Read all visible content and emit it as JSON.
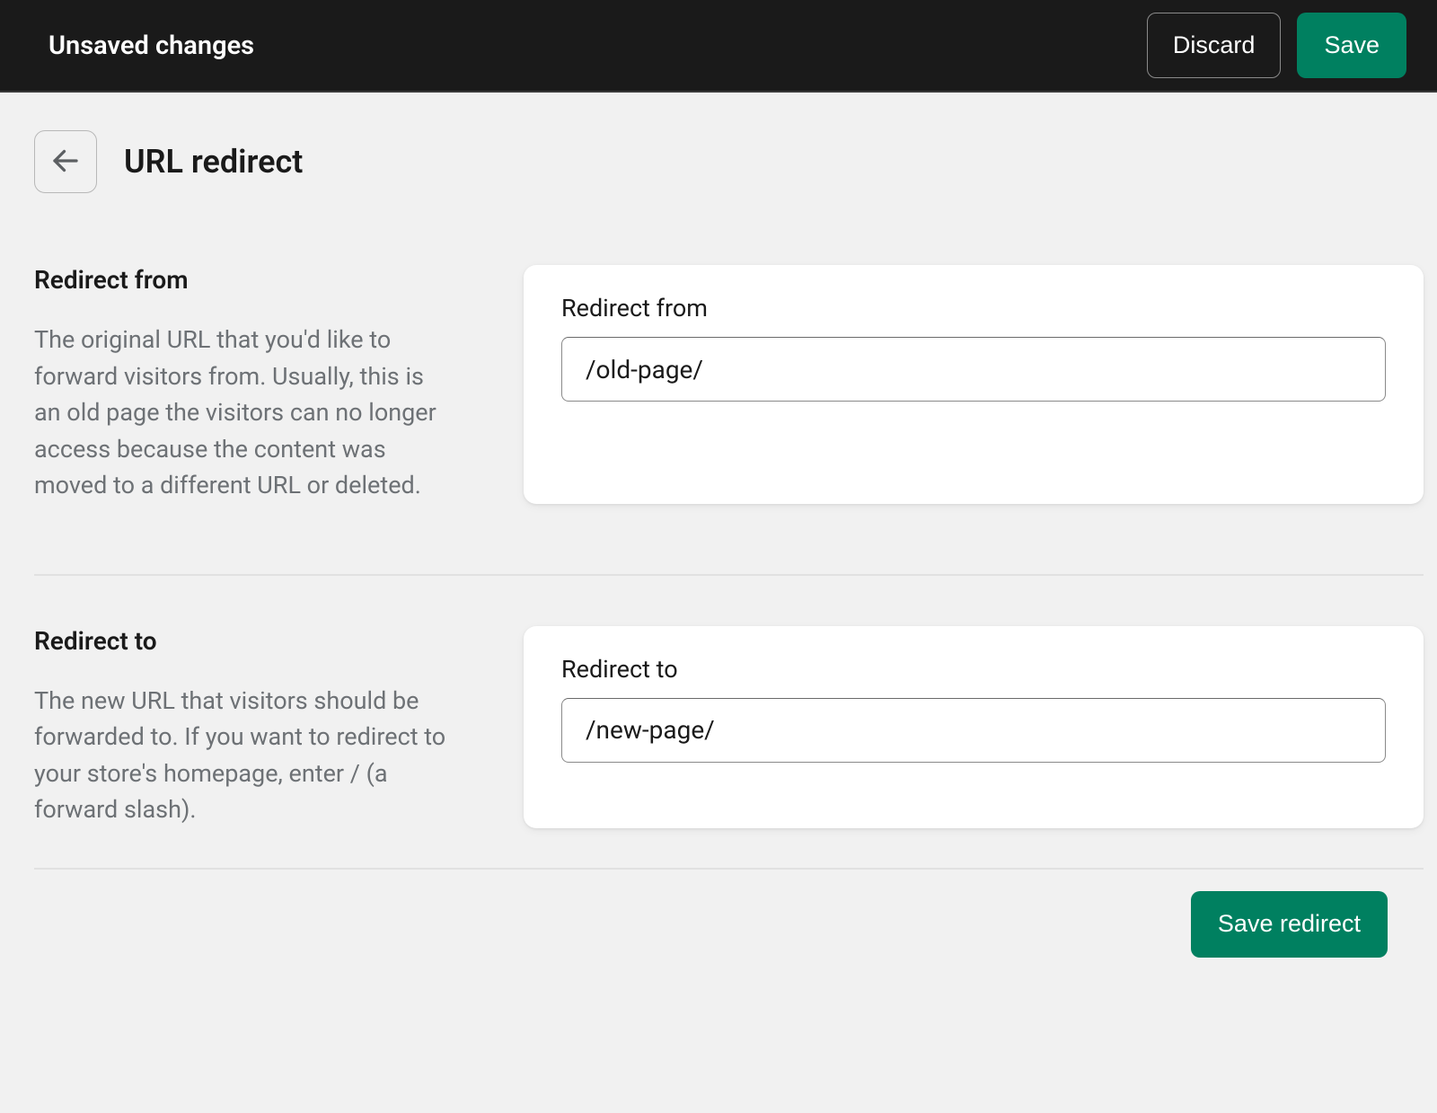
{
  "top_bar": {
    "title": "Unsaved changes",
    "discard_label": "Discard",
    "save_label": "Save"
  },
  "page": {
    "title": "URL redirect"
  },
  "sections": {
    "redirect_from": {
      "heading": "Redirect from",
      "description": "The original URL that you'd like to forward visitors from. Usually, this is an old page the visitors can no longer access because the content was moved to a different URL or deleted.",
      "field_label": "Redirect from",
      "field_value": "/old-page/"
    },
    "redirect_to": {
      "heading": "Redirect to",
      "description": "The new URL that visitors should be forwarded to. If you want to redirect to your store's homepage, enter / (a forward slash).",
      "field_label": "Redirect to",
      "field_value": "/new-page/"
    }
  },
  "footer": {
    "save_redirect_label": "Save redirect"
  },
  "icons": {
    "back_arrow": "arrow-left"
  }
}
